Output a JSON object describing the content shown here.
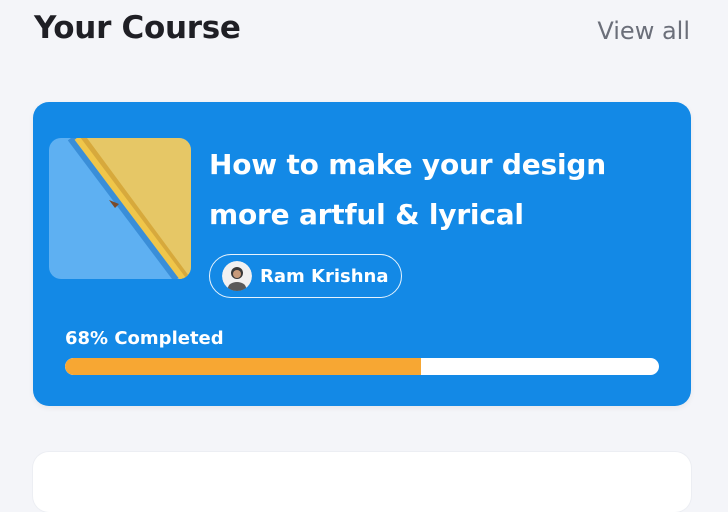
{
  "header": {
    "title": "Your Course",
    "view_all_label": "View all"
  },
  "course": {
    "title": "How to make your design more artful & lyrical",
    "author": "Ram Krishna",
    "progress_label": "68% Completed",
    "progress_fraction": 0.6,
    "colors": {
      "card": "#1389e6",
      "progress_fill": "#f7a733",
      "progress_track": "#ffffff"
    },
    "thumbnail_icon": "pencil-thumbnail",
    "avatar_icon": "author-avatar"
  }
}
